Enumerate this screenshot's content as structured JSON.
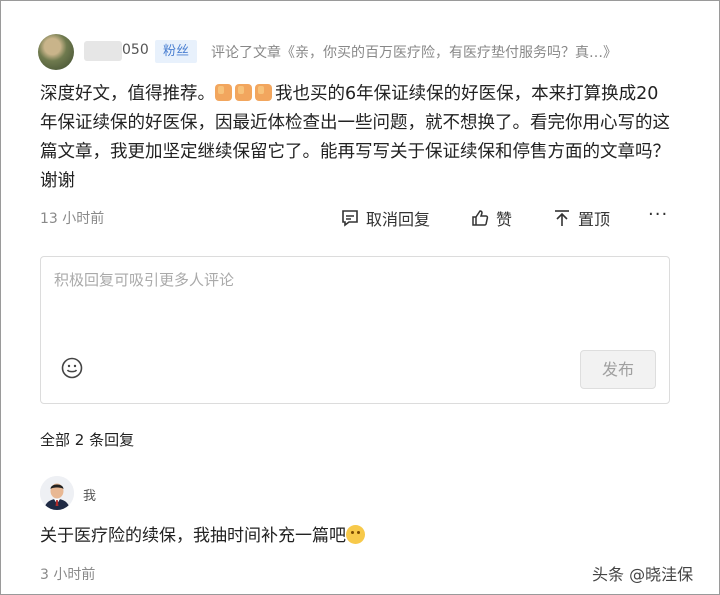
{
  "header": {
    "username_suffix": "050",
    "badge": "粉丝",
    "action_text": "评论了文章《亲，你买的百万医疗险，有医疗垫付服务吗？真…》"
  },
  "comment": {
    "text_before_emoji": "深度好文，值得推荐。",
    "emoji": "thumbs-up-emoji",
    "text_after_emoji": "我也买的6年保证续保的好医保，本来打算换成20年保证续保的好医保，因最近体检查出一些问题，就不想换了。看完你用心写的这篇文章，我更加坚定继续保留它了。能再写写关于保证续保和停售方面的文章吗？谢谢",
    "time": "13 小时前",
    "cancel_reply": "取消回复",
    "like": "赞",
    "pin": "置顶",
    "more": "···"
  },
  "reply_box": {
    "placeholder": "积极回复可吸引更多人评论",
    "publish": "发布"
  },
  "replies": {
    "count_label": "全部 2 条回复",
    "items": [
      {
        "author": "我",
        "text": "关于医疗险的续保，我抽时间补充一篇吧",
        "emoji": "smile-emoji",
        "time": "3 小时前"
      }
    ]
  },
  "watermark": "头条 @晓洼保"
}
